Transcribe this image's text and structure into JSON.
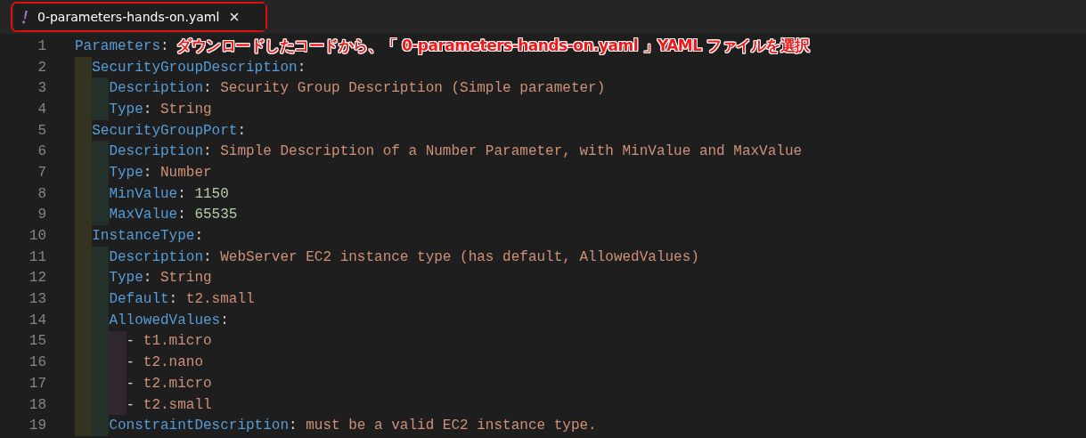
{
  "tab": {
    "label": "0-parameters-hands-on.yaml",
    "selected": true
  },
  "annotation": "ダウンロードしたコードから、「 0-parameters-hands-on.yaml 」YAML ファイルを選択",
  "lines": [
    {
      "number": "1",
      "kind": "key",
      "key": "Parameters",
      "separator": ":",
      "children": [
        {
          "number": "2",
          "kind": "key",
          "key": "SecurityGroupDescription",
          "separator": ":",
          "children": [
            {
              "number": "3",
              "kind": "key",
              "key": "Description",
              "separator": ":",
              "value": {
                "kind": "string",
                "text": "Security Group Description (Simple parameter)"
              }
            },
            {
              "number": "4",
              "kind": "key",
              "key": "Type",
              "separator": ":",
              "value": {
                "kind": "string",
                "text": "String"
              }
            }
          ]
        },
        {
          "number": "5",
          "kind": "key",
          "key": "SecurityGroupPort",
          "separator": ":",
          "children": [
            {
              "number": "6",
              "kind": "key",
              "key": "Description",
              "separator": ":",
              "value": {
                "kind": "string",
                "text": "Simple Description of a Number Parameter, with MinValue and MaxValue"
              }
            },
            {
              "number": "7",
              "kind": "key",
              "key": "Type",
              "separator": ":",
              "value": {
                "kind": "string",
                "text": "Number"
              }
            },
            {
              "number": "8",
              "kind": "key",
              "key": "MinValue",
              "separator": ":",
              "value": {
                "kind": "number",
                "text": "1150"
              }
            },
            {
              "number": "9",
              "kind": "key",
              "key": "MaxValue",
              "separator": ":",
              "value": {
                "kind": "number",
                "text": "65535"
              }
            }
          ]
        },
        {
          "number": "10",
          "kind": "key",
          "key": "InstanceType",
          "separator": ":",
          "children": [
            {
              "number": "11",
              "kind": "key",
              "key": "Description",
              "separator": ":",
              "value": {
                "kind": "string",
                "text": "WebServer EC2 instance type (has default, AllowedValues)"
              }
            },
            {
              "number": "12",
              "kind": "key",
              "key": "Type",
              "separator": ":",
              "value": {
                "kind": "string",
                "text": "String"
              }
            },
            {
              "number": "13",
              "kind": "key",
              "key": "Default",
              "separator": ":",
              "value": {
                "kind": "string",
                "text": "t2.small"
              }
            },
            {
              "number": "14",
              "kind": "key",
              "key": "AllowedValues",
              "separator": ":",
              "children": [
                {
                  "number": "15",
                  "kind": "item",
                  "marker": "-",
                  "value": {
                    "kind": "string",
                    "text": "t1.micro"
                  }
                },
                {
                  "number": "16",
                  "kind": "item",
                  "marker": "-",
                  "value": {
                    "kind": "string",
                    "text": "t2.nano"
                  }
                },
                {
                  "number": "17",
                  "kind": "item",
                  "marker": "-",
                  "value": {
                    "kind": "string",
                    "text": "t2.micro"
                  }
                },
                {
                  "number": "18",
                  "kind": "item",
                  "marker": "-",
                  "value": {
                    "kind": "string",
                    "text": "t2.small"
                  }
                }
              ]
            },
            {
              "number": "19",
              "kind": "key",
              "key": "ConstraintDescription",
              "separator": ":",
              "value": {
                "kind": "string",
                "text": "must be a valid EC2 instance type."
              }
            }
          ]
        }
      ]
    }
  ]
}
